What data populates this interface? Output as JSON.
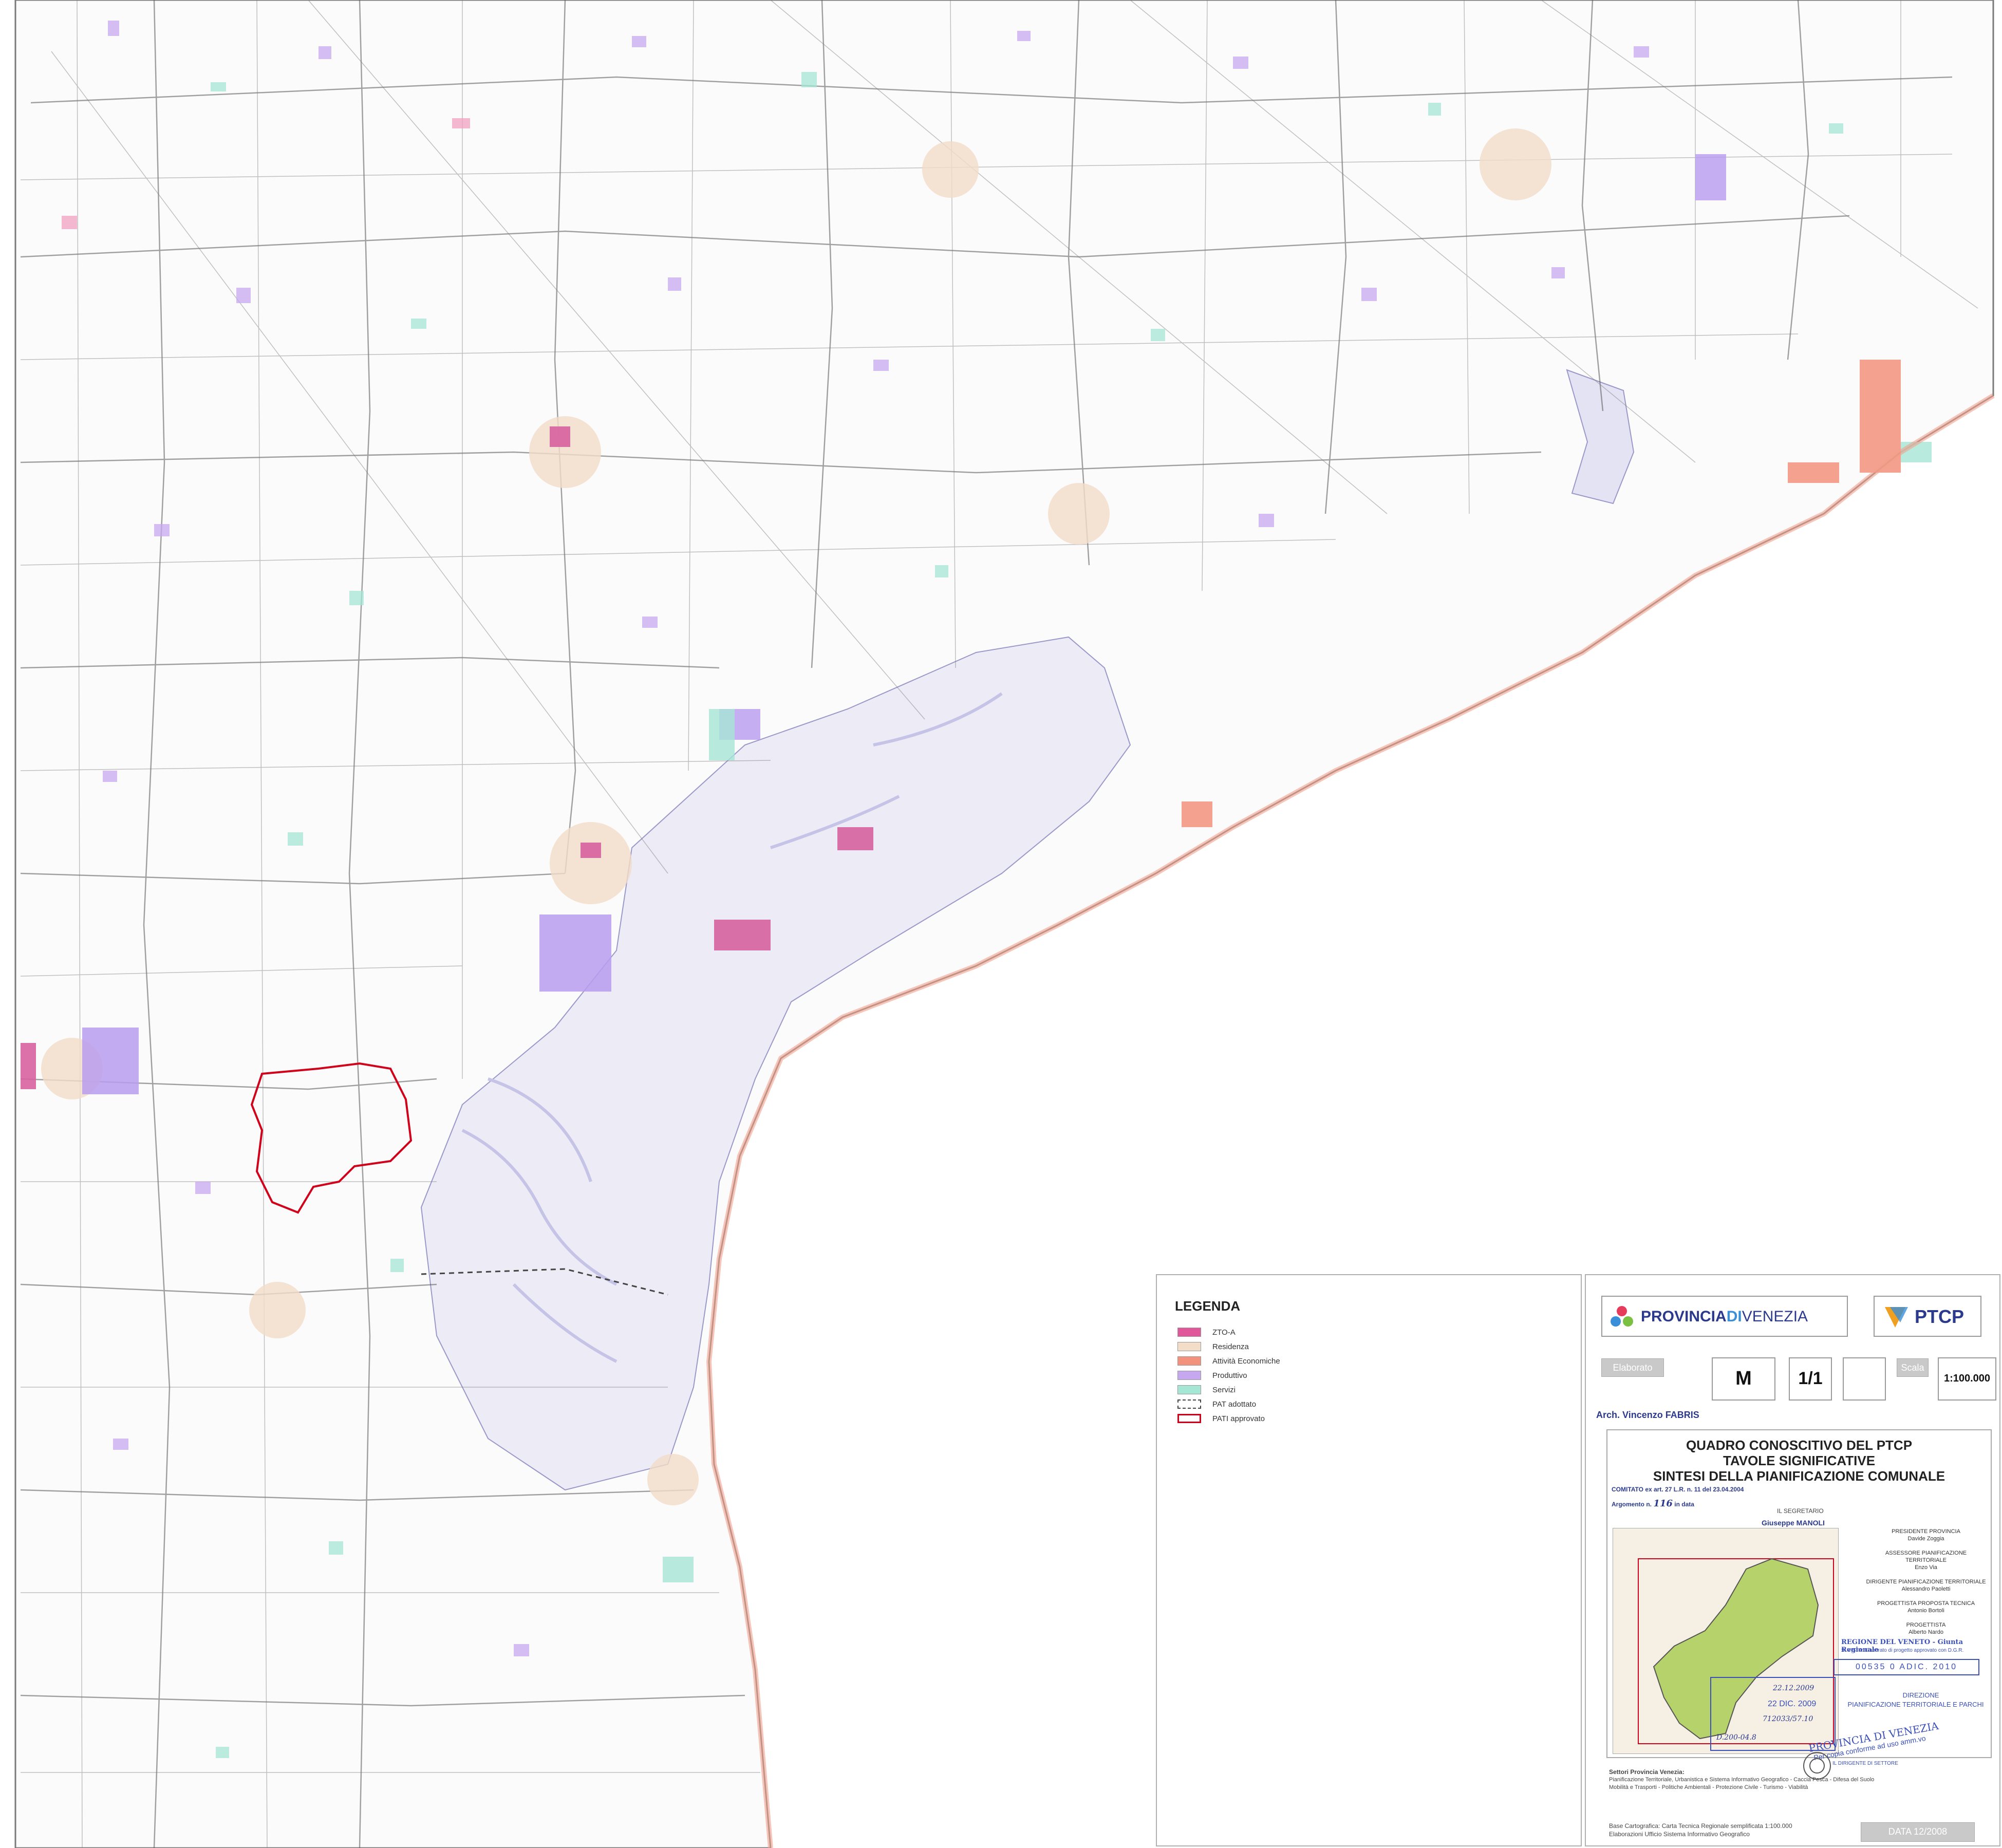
{
  "legend": {
    "title": "LEGENDA",
    "items": [
      {
        "label": "ZTO-A",
        "color": "#e0589a",
        "style": "fill"
      },
      {
        "label": "Residenza",
        "color": "#f3dcc8",
        "style": "fill"
      },
      {
        "label": "Attività Economiche",
        "color": "#f2917c",
        "style": "fill"
      },
      {
        "label": "Produttivo",
        "color": "#c6a8f0",
        "style": "fill"
      },
      {
        "label": "Servizi",
        "color": "#a6e6d4",
        "style": "fill"
      },
      {
        "label": "PAT adottato",
        "color": "#444444",
        "style": "dashed-outline"
      },
      {
        "label": "PATI approvato",
        "color": "#d0021b",
        "style": "outline"
      }
    ]
  },
  "title_block": {
    "logo_left": {
      "part1": "PROVINCIA",
      "part2": "DI",
      "part3": "VENEZIA"
    },
    "logo_right": "PTCP",
    "elaborato_label": "Elaborato",
    "elaborato_code": "M",
    "sheet": "1/1",
    "scala_label": "Scala",
    "scala_value": "1:100.000",
    "signature_author": "Arch. Vincenzo FABRIS",
    "title_lines": [
      "QUADRO CONOSCITIVO DEL PTCP",
      "TAVOLE SIGNIFICATIVE",
      "SINTESI DELLA PIANIFICAZIONE COMUNALE"
    ],
    "committee_line": "COMITATO ex art. 27 L.R. n. 11 del 23.04.2004",
    "argomento_line": "Argomento n.",
    "argomento_value": "116",
    "data_label": "in data",
    "secretary_label": "IL SEGRETARIO",
    "secretary_name": "Giuseppe MANOLI",
    "officials": [
      {
        "role": "PRESIDENTE PROVINCIA",
        "name": "Davide Zoggia"
      },
      {
        "role": "ASSESSORE PIANIFICAZIONE TERRITORIALE",
        "name": "Enzo Via"
      },
      {
        "role": "DIRIGENTE PIANIFICAZIONE TERRITORIALE",
        "name": "Alessandro Paoletti"
      },
      {
        "role": "PROGETTISTA PROPOSTA TECNICA",
        "name": "Antonio Bortoli"
      },
      {
        "role": "PROGETTISTA",
        "name": "Alberto Nardo"
      }
    ],
    "regione_line1": "REGIONE DEL VENETO - Giunta Regionale",
    "regione_line2": "SI VISTA: Elaborato di progetto approvato con D.G.R.",
    "stamp_number": "00535 0 ADIC. 2010",
    "direzione_line1": "DIREZIONE",
    "direzione_line2": "PIANIFICAZIONE TERRITORIALE E PARCHI",
    "stamp_date1": "22.12.2009",
    "stamp_date2": "22 DIC. 2009",
    "stamp_prot": "712033/57.10",
    "stamp_class": "D.200-04.8",
    "provincia_stamp_line1": "PROVINCIA DI VENEZIA",
    "provincia_stamp_line2": "Per copia conforme ad uso amm.vo",
    "provincia_stamp_line3": "IL DIRIGENTE DI SETTORE",
    "settori_title": "Settori Provincia Venezia:",
    "settori_line1": "Pianificazione Territoriale, Urbanistica e Sistema Informativo Geografico - Caccia Pesca - Difesa del Suolo",
    "settori_line2": "Mobilità e Trasporti - Politiche Ambientali - Protezione Civile - Turismo - Viabilità",
    "base_line1": "Base Cartografica: Carta Tecnica Regionale semplificata 1:100.000",
    "base_line2": "Elaborazioni Ufficio Sistema Informativo Geografico",
    "data_badge": "DATA 12/2008"
  }
}
